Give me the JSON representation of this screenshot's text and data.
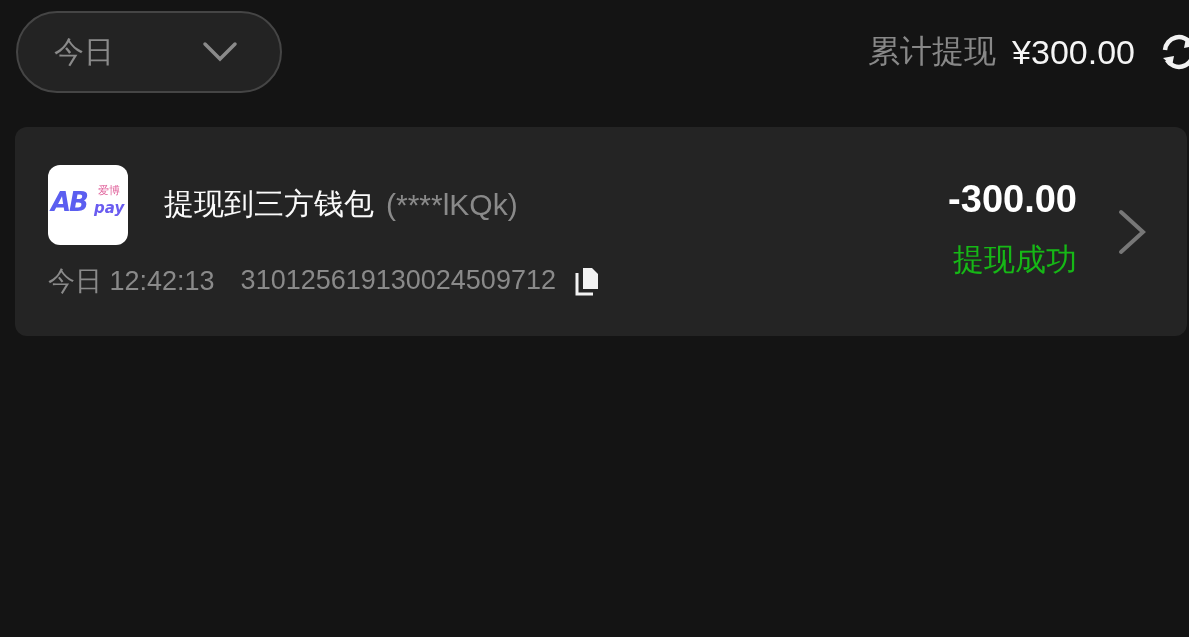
{
  "filter": {
    "value": "今日"
  },
  "summary": {
    "label": "累计提现",
    "amount": "¥300.00"
  },
  "records": [
    {
      "kind": "success",
      "logo": {
        "mark": "AB",
        "cn": "爱博",
        "en": "pay"
      },
      "title": "提现到三方钱包",
      "account": "(****lKQk)",
      "date": "今日 12:42:13",
      "order_no": "310125619130024509712",
      "amount": "-300.00",
      "status": "提现成功"
    }
  ]
}
